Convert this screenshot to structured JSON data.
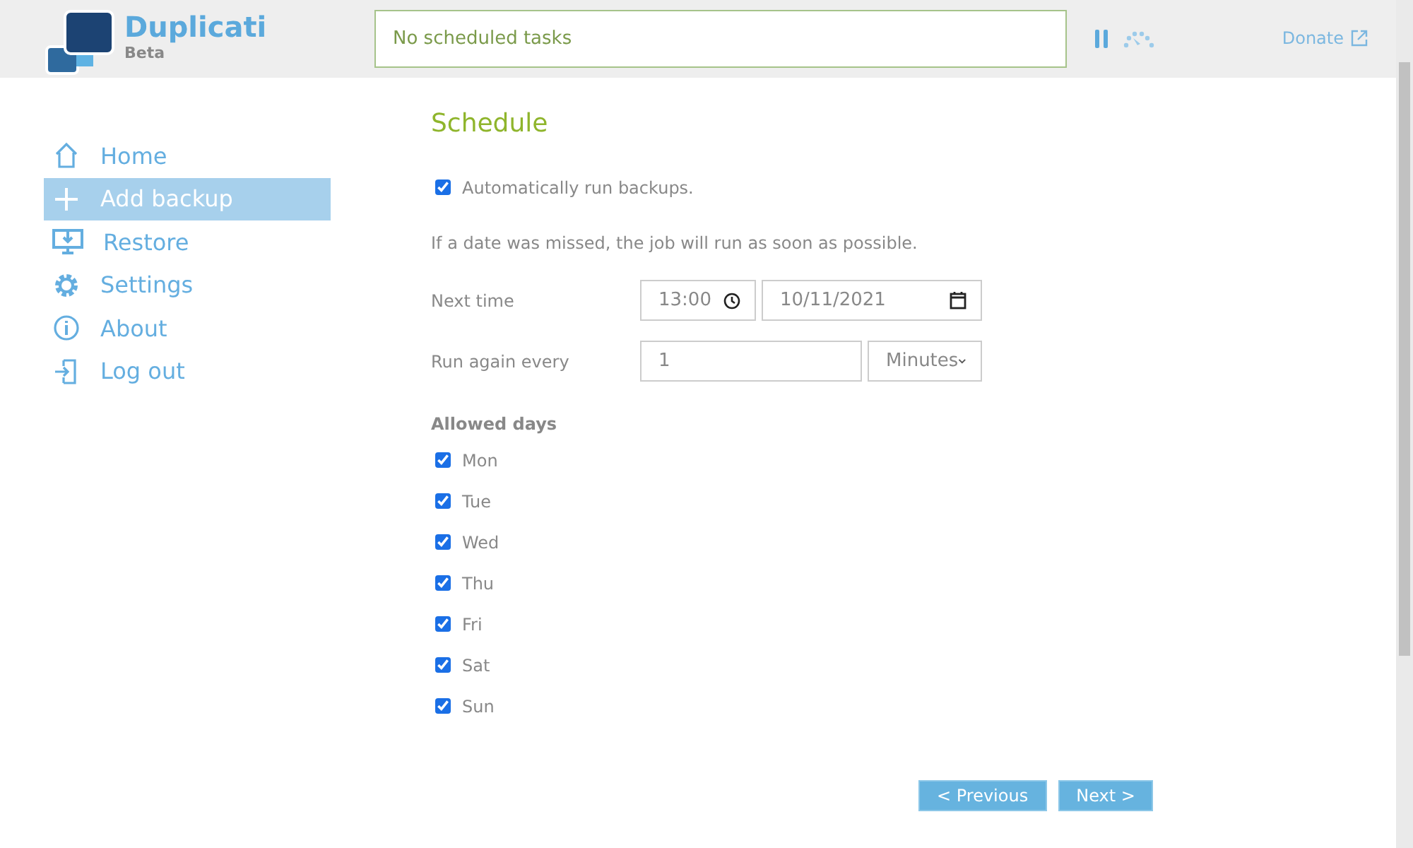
{
  "header": {
    "app_name": "Duplicati",
    "edition": "Beta",
    "status": "No scheduled tasks",
    "donate": "Donate"
  },
  "sidebar": {
    "items": [
      {
        "label": "Home",
        "selected": false
      },
      {
        "label": "Add backup",
        "selected": true
      },
      {
        "label": "Restore",
        "selected": false
      },
      {
        "label": "Settings",
        "selected": false
      },
      {
        "label": "About",
        "selected": false
      },
      {
        "label": "Log out",
        "selected": false
      }
    ]
  },
  "schedule": {
    "title": "Schedule",
    "auto_run": {
      "label": "Automatically run backups.",
      "checked": true
    },
    "note": "If a date was missed, the job will run as soon as possible.",
    "next_time": {
      "label": "Next time",
      "time": "13:00",
      "date": "10/11/2021"
    },
    "repeat": {
      "label": "Run again every",
      "value": "1",
      "unit": "Minutes"
    },
    "allowed_days_label": "Allowed days",
    "days": [
      {
        "label": "Mon",
        "checked": true
      },
      {
        "label": "Tue",
        "checked": true
      },
      {
        "label": "Wed",
        "checked": true
      },
      {
        "label": "Thu",
        "checked": true
      },
      {
        "label": "Fri",
        "checked": true
      },
      {
        "label": "Sat",
        "checked": true
      },
      {
        "label": "Sun",
        "checked": true
      }
    ]
  },
  "buttons": [
    {
      "label": "< Previous"
    },
    {
      "label": "Next >"
    }
  ]
}
